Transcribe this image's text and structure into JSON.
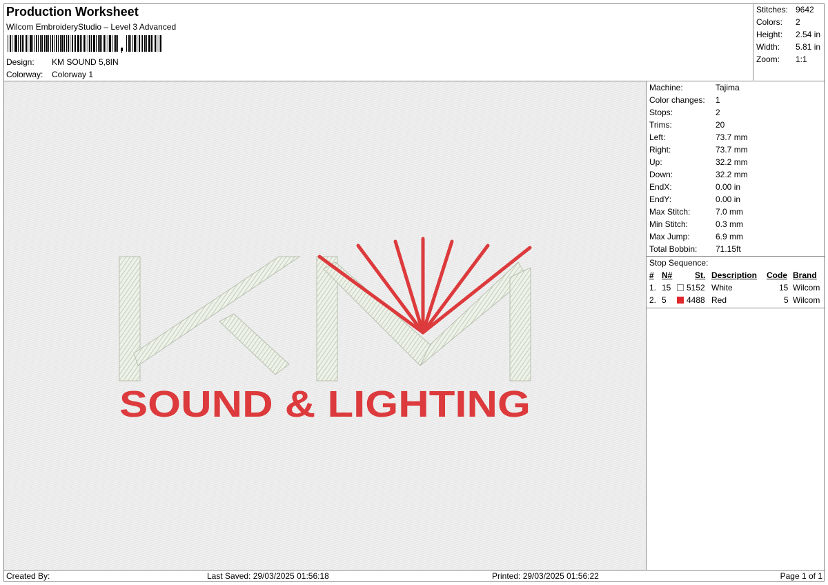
{
  "header": {
    "title": "Production Worksheet",
    "subtitle": "Wilcom EmbroideryStudio – Level 3 Advanced",
    "design_label": "Design:",
    "design_value": "KM SOUND 5,8IN",
    "colorway_label": "Colorway:",
    "colorway_value": "Colorway 1"
  },
  "summary": {
    "stitches_label": "Stitches:",
    "stitches_value": "9642",
    "colors_label": "Colors:",
    "colors_value": "2",
    "height_label": "Height:",
    "height_value": "2.54 in",
    "width_label": "Width:",
    "width_value": "5.81 in",
    "zoom_label": "Zoom:",
    "zoom_value": "1:1"
  },
  "info": {
    "machine_label": "Machine:",
    "machine_value": "Tajima",
    "color_changes_label": "Color changes:",
    "color_changes_value": "1",
    "stops_label": "Stops:",
    "stops_value": "2",
    "trims_label": "Trims:",
    "trims_value": "20",
    "left_label": "Left:",
    "left_value": "73.7 mm",
    "right_label": "Right:",
    "right_value": "73.7 mm",
    "up_label": "Up:",
    "up_value": "32.2 mm",
    "down_label": "Down:",
    "down_value": "32.2 mm",
    "endx_label": "EndX:",
    "endx_value": "0.00 in",
    "endy_label": "EndY:",
    "endy_value": "0.00 in",
    "max_stitch_label": "Max Stitch:",
    "max_stitch_value": "7.0 mm",
    "min_stitch_label": "Min Stitch:",
    "min_stitch_value": "0.3 mm",
    "max_jump_label": "Max Jump:",
    "max_jump_value": "6.9 mm",
    "total_bobbin_label": "Total Bobbin:",
    "total_bobbin_value": "71.15ft"
  },
  "stop_sequence": {
    "title": "Stop Sequence:",
    "headers": {
      "num": "#",
      "n": "N#",
      "st": "St.",
      "description": "Description",
      "code": "Code",
      "brand": "Brand"
    },
    "rows": [
      {
        "num": "1.",
        "n": "15",
        "color": "#ffffff",
        "st": "5152",
        "description": "White",
        "code": "15",
        "brand": "Wilcom"
      },
      {
        "num": "2.",
        "n": "5",
        "color": "#e0262a",
        "st": "4488",
        "description": "Red",
        "code": "5",
        "brand": "Wilcom"
      }
    ]
  },
  "footer": {
    "created_by": "Created By:",
    "last_saved": "Last Saved: 29/03/2025 01:56:18",
    "printed": "Printed: 29/03/2025 01:56:22",
    "page": "Page 1 of 1"
  },
  "design_preview": {
    "logo_text": "SOUND & LIGHTING",
    "thread_white": "#eef2e8",
    "thread_white_shade": "#c9d1c2",
    "thread_red": "#dc3a3c"
  }
}
